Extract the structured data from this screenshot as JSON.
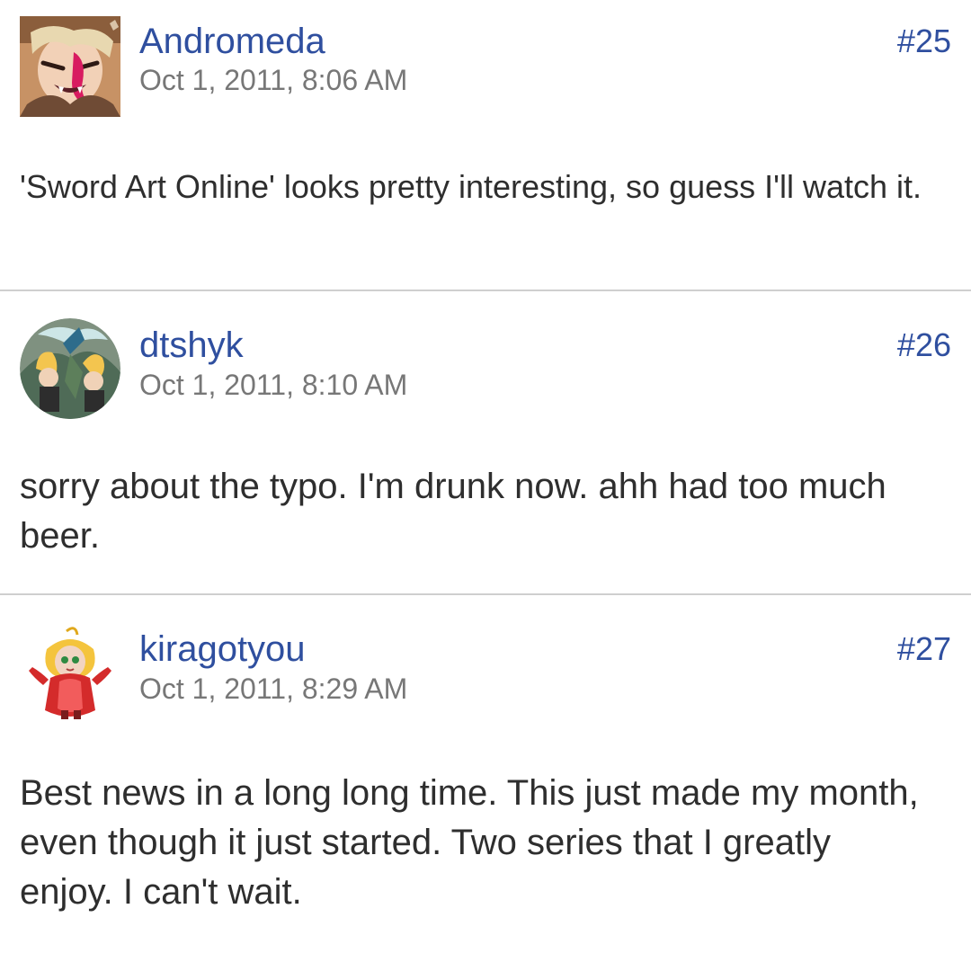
{
  "posts": [
    {
      "author": "Andromeda",
      "date": "Oct 1, 2011, 8:06 AM",
      "number": "#25",
      "message": "'Sword Art Online' looks pretty interesting, so guess I'll watch it."
    },
    {
      "author": "dtshyk",
      "date": "Oct 1, 2011, 8:10 AM",
      "number": "#26",
      "message": "sorry about the typo. I'm drunk now. ahh had too much beer."
    },
    {
      "author": "kiragotyou",
      "date": "Oct 1, 2011, 8:29 AM",
      "number": "#27",
      "message": "Best news in a long long time. This just made my month, even though it just started. Two series that I greatly enjoy. I can't wait."
    }
  ],
  "colors": {
    "author": "#2f4f9f",
    "post_number": "#2f4f9f",
    "date": "#777777",
    "divider": "#cfcfcf"
  }
}
